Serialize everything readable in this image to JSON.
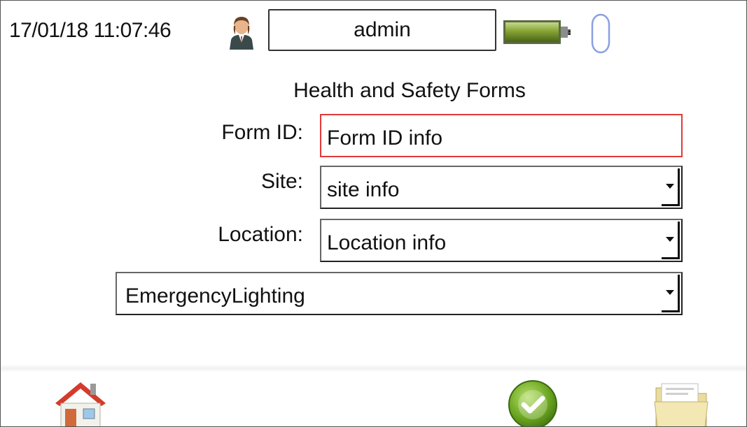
{
  "status_bar": {
    "datetime": "17/01/18 11:07:46",
    "user": "admin",
    "icons": [
      "user-icon",
      "battery-icon",
      "mouse-icon"
    ]
  },
  "form": {
    "title": "Health and Safety Forms",
    "form_id": {
      "label": "Form ID:",
      "value": "Form ID info"
    },
    "site": {
      "label": "Site:",
      "value": "site info"
    },
    "location": {
      "label": "Location:",
      "value": "Location info"
    },
    "form_type": {
      "value": "EmergencyLighting"
    }
  },
  "toolbar": {
    "buttons": [
      "home-icon",
      "confirm-icon",
      "folder-icon"
    ]
  },
  "colors": {
    "form_id_border": "#e03a3a",
    "confirm_green": "#6aa520",
    "battery_green": "#7a9a2a",
    "home_roof_red": "#d63a2a",
    "mouse_blue": "#8aa0e0"
  }
}
